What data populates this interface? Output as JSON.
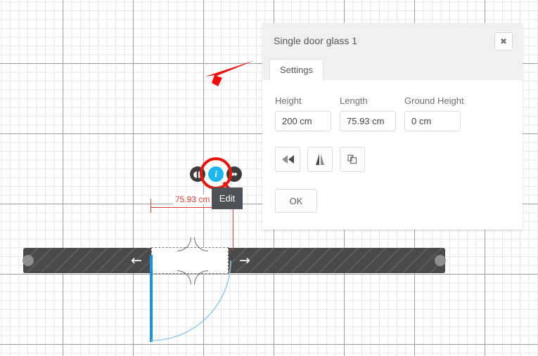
{
  "canvas": {
    "dimension_label": "75.93 cm",
    "tooltip_label": "Edit",
    "pills": [
      {
        "name": "move-handle",
        "glyph": "◖◗"
      },
      {
        "name": "info-handle",
        "glyph": "i"
      },
      {
        "name": "resize-handle",
        "glyph": "⬌"
      }
    ],
    "wall_arrow_left": "←",
    "wall_arrow_right": "→",
    "accent_red": "#e03c31",
    "highlight_red": "#e8160c",
    "door_blue": "#1e8ee0",
    "info_blue": "#1fb6ef",
    "wall_color": "#4a4a4a"
  },
  "dialog": {
    "title": "Single door glass 1",
    "close_label": "✖",
    "tabs": [
      {
        "label": "Settings",
        "active": true
      }
    ],
    "fields": [
      {
        "label": "Height",
        "value": "200 cm",
        "placeholder": "Height"
      },
      {
        "label": "Length",
        "value": "75.93 cm",
        "placeholder": "Length"
      },
      {
        "label": "Ground Height",
        "value": "0 cm",
        "placeholder": "Ground Height"
      }
    ],
    "tools": [
      {
        "name": "flip-horizontal-button",
        "title": "Flip horizontal"
      },
      {
        "name": "flip-vertical-button",
        "title": "Flip vertical"
      },
      {
        "name": "duplicate-button",
        "title": "Duplicate"
      }
    ],
    "ok_label": "OK"
  }
}
